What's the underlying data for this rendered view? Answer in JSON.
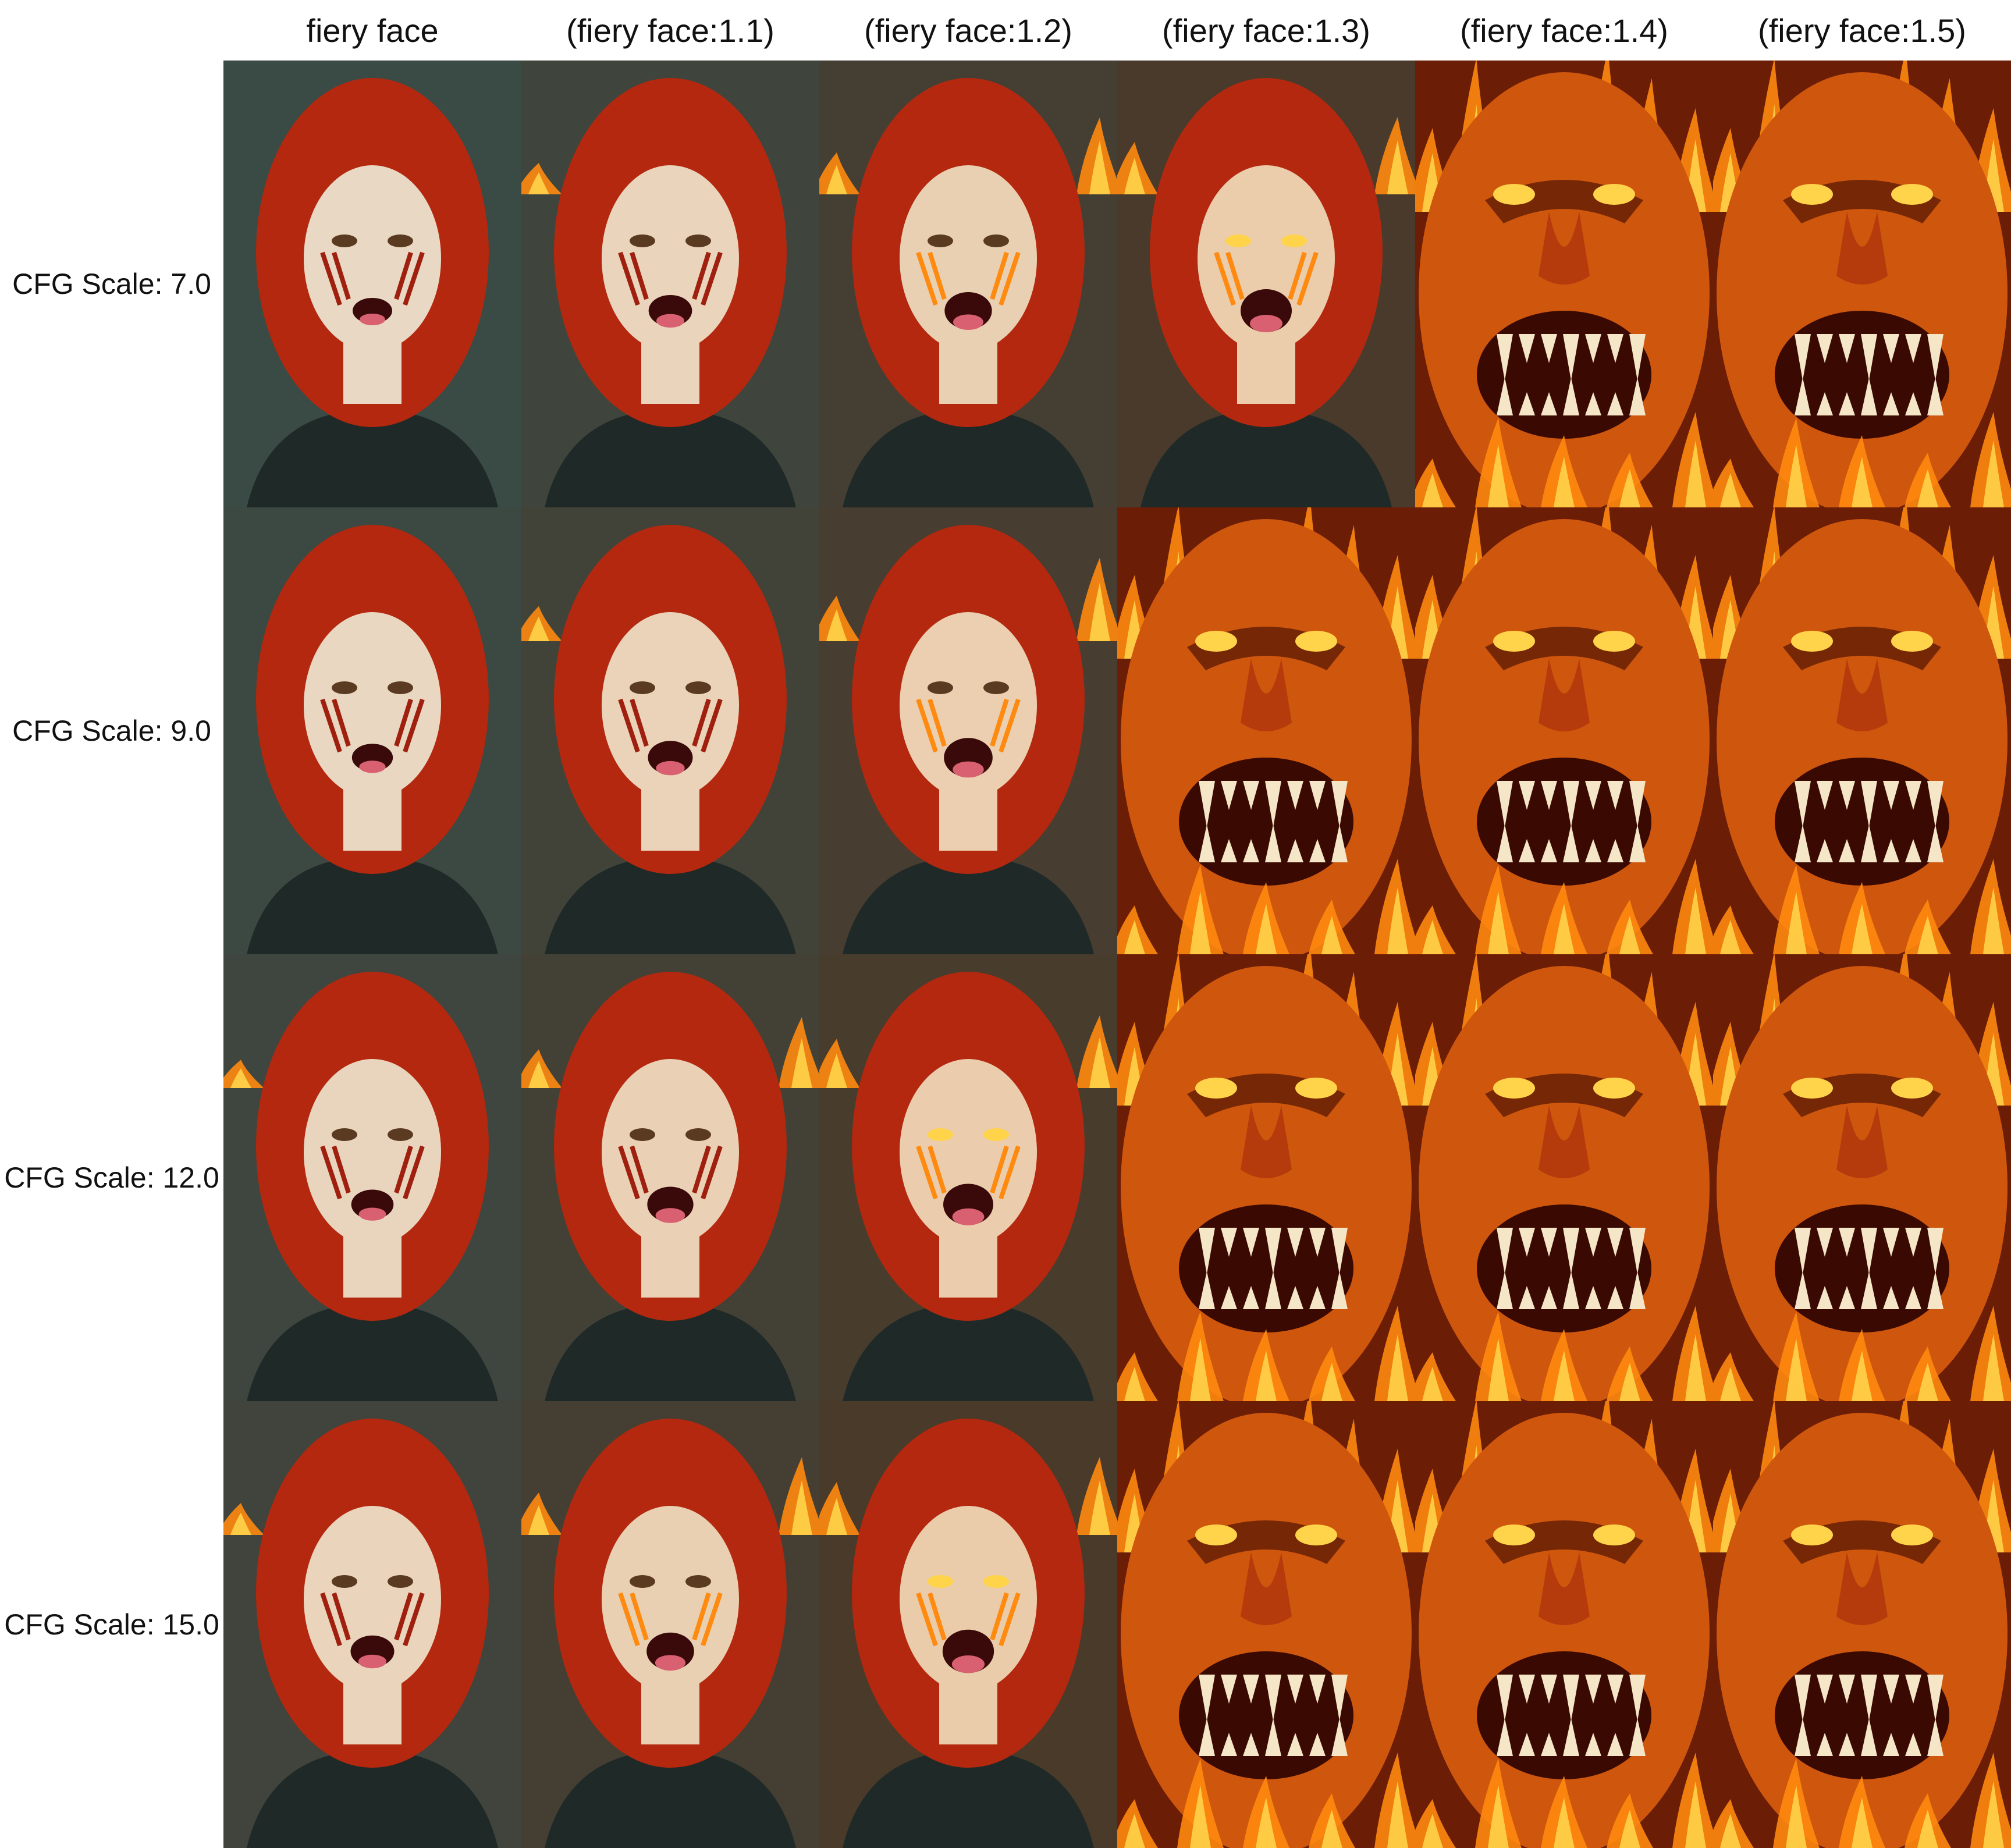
{
  "columns": [
    "fiery face",
    "(fiery face:1.1)",
    "(fiery face:1.2)",
    "(fiery face:1.3)",
    "(fiery face:1.4)",
    "(fiery face:1.5)"
  ],
  "rows": [
    "CFG Scale: 7.0",
    "CFG Scale: 9.0",
    "CFG Scale: 12.0",
    "CFG Scale: 15.0"
  ],
  "palette": {
    "bg_cool": "#3a4a45",
    "hair": "#b3280f",
    "skin": "#e9d8c4",
    "fire": "#ff8a10",
    "fire_hot": "#ffd34a",
    "demon": "#b53a0c",
    "demon_dark": "#3a0a02"
  }
}
